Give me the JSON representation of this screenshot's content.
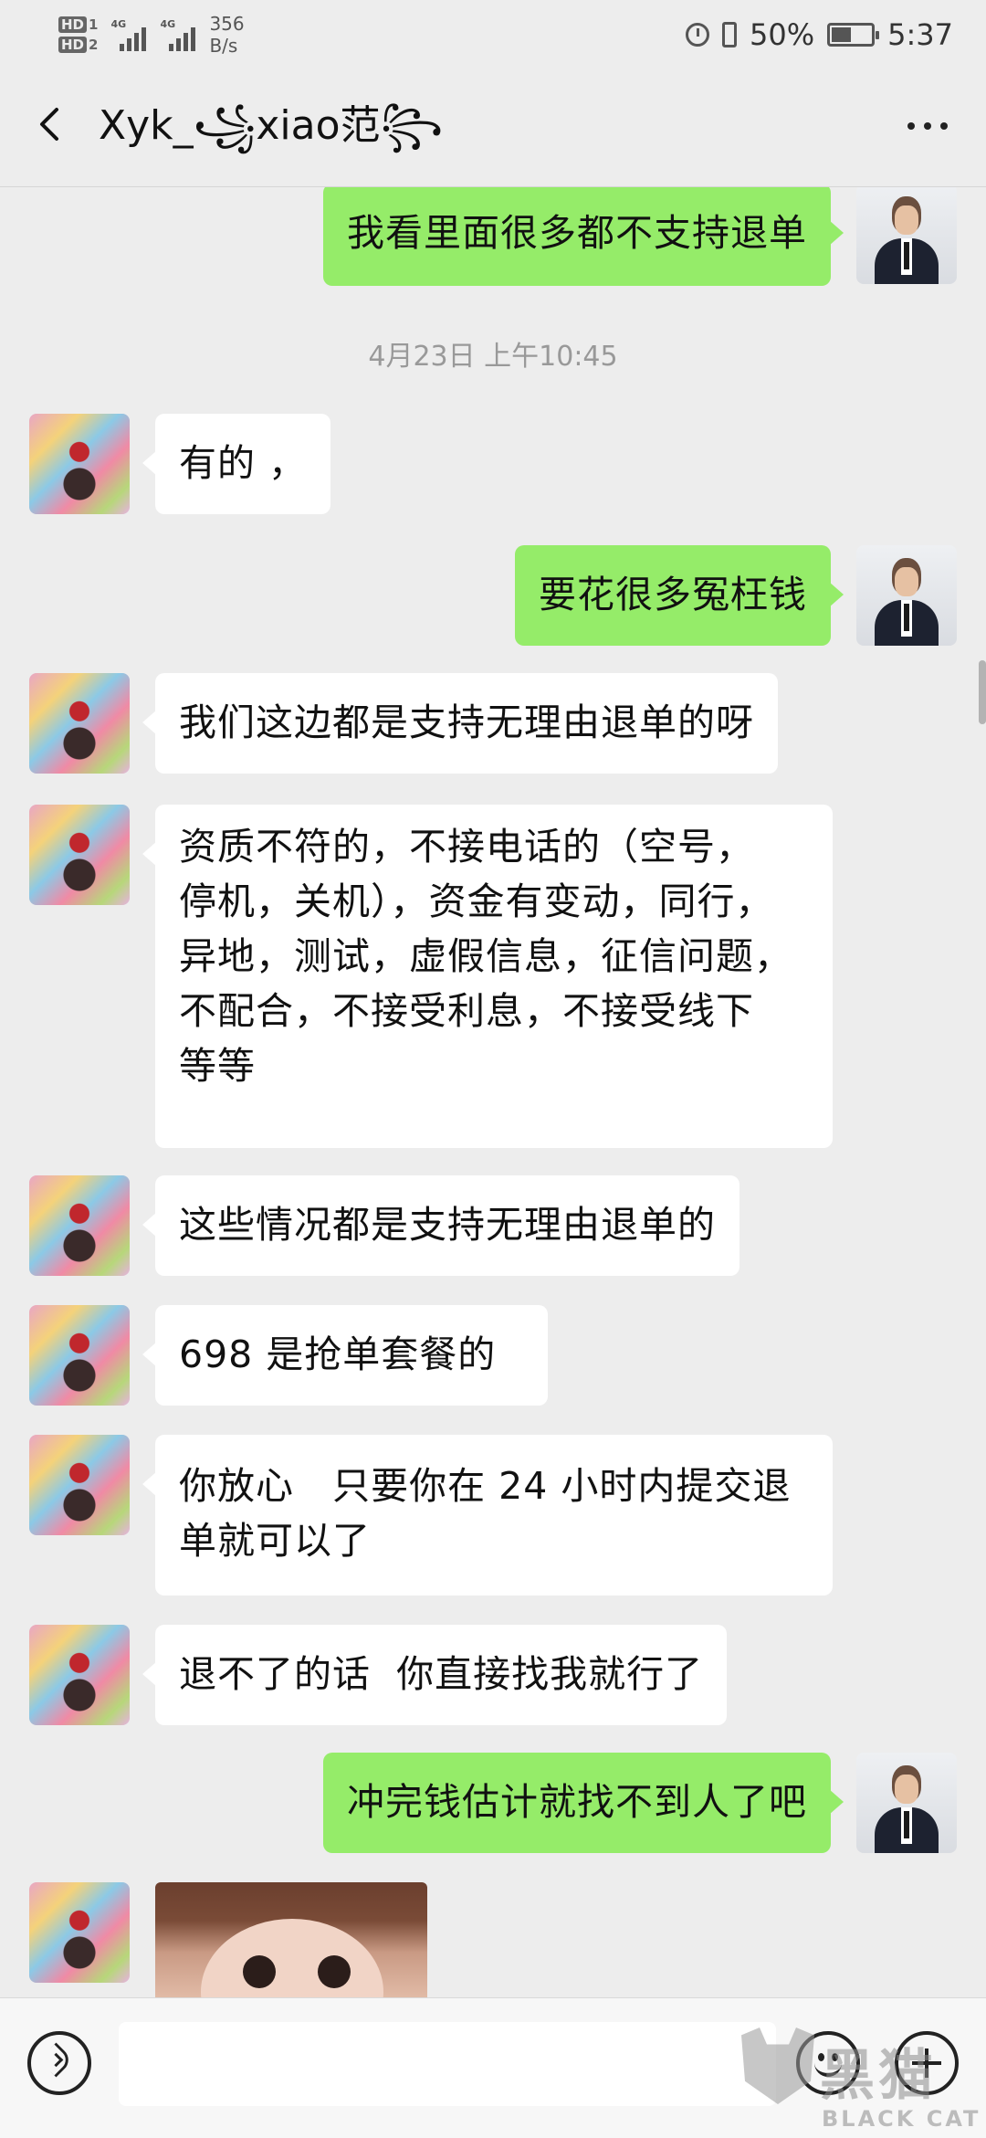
{
  "status_bar": {
    "hd1": "HD",
    "hd1_sub": "1",
    "hd2": "HD",
    "hd2_sub": "2",
    "net1": "4G",
    "net2": "4G",
    "speed_value": "356",
    "speed_unit": "B/s",
    "battery": "50%",
    "battery_level": 0.5,
    "time": "5:37"
  },
  "header": {
    "title": "Xyk_꧁xiao范꧂",
    "back_icon": "chevron-left-icon",
    "more_icon": "more-dots-icon"
  },
  "messages": [
    {
      "from": "me",
      "text": "我看里面很多都不支持退单"
    },
    {
      "timestamp": "4月23日 上午10:45"
    },
    {
      "from": "other",
      "text": "有的 ，"
    },
    {
      "from": "me",
      "text": "要花很多冤枉钱"
    },
    {
      "from": "other",
      "text": "我们这边都是支持无理由退单的呀"
    },
    {
      "from": "other",
      "lines": [
        "资质不符的，不接电话的（空号，",
        "停机，关机），资金有变动，同行，",
        "异地，测试，虚假信息，征信问题，",
        "不配合，不接受利息，不接受线下",
        "等等"
      ]
    },
    {
      "from": "other",
      "text": "这些情况都是支持无理由退单的"
    },
    {
      "from": "other",
      "text": "698 是抢单套餐的"
    },
    {
      "from": "other",
      "lines": [
        "你放心   只要你在 24 小时内提交退",
        "单就可以了"
      ]
    },
    {
      "from": "other",
      "text": "退不了的话  你直接找我就行了"
    },
    {
      "from": "me",
      "text": "冲完钱估计就找不到人了吧"
    },
    {
      "from": "other",
      "image": "photo-of-child"
    }
  ],
  "input_bar": {
    "voice_icon": "voice-icon",
    "emoji_icon": "emoji-icon",
    "plus_icon": "plus-icon",
    "input_value": ""
  },
  "watermark": {
    "cn": "黑猫",
    "en": "BLACK CAT"
  },
  "colors": {
    "background": "#ededed",
    "bubble_out": "#95ec69",
    "bubble_in": "#ffffff"
  }
}
